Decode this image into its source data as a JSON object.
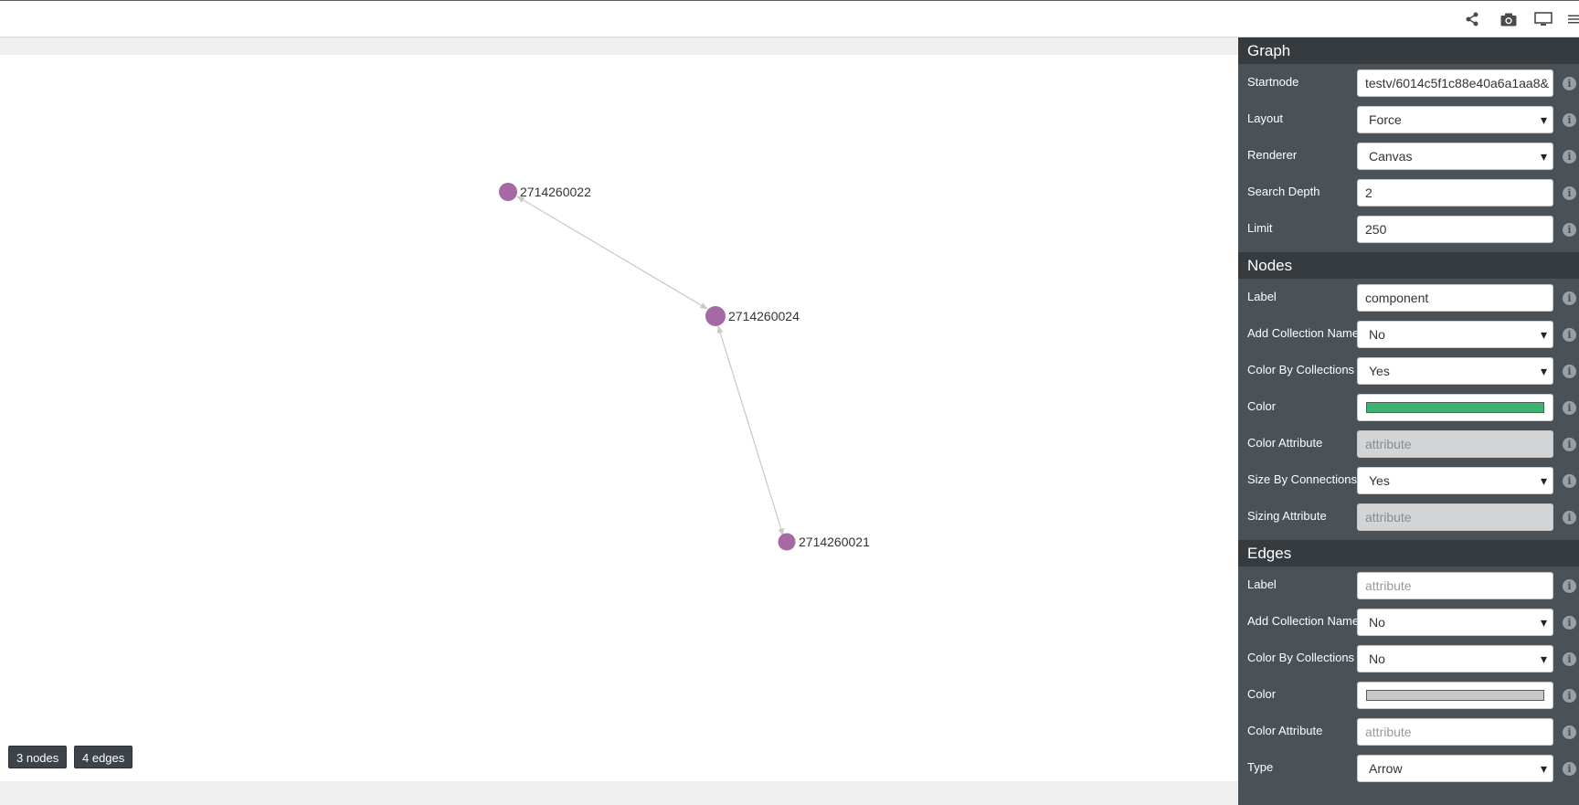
{
  "toolbar": {
    "icons": [
      "share-icon",
      "camera-icon",
      "monitor-icon",
      "menu-icon"
    ]
  },
  "graph": {
    "nodes": [
      {
        "id": "2714260022"
      },
      {
        "id": "2714260024"
      },
      {
        "id": "2714260021"
      }
    ],
    "node_color": "#a569a3",
    "edge_color": "#c8c8c8"
  },
  "badges": {
    "nodes": "3 nodes",
    "edges": "4 edges"
  },
  "panel": {
    "graph_section": {
      "title": "Graph",
      "startnode_label": "Startnode",
      "startnode_value": "testv/6014c5f1c88e40a6a1aa8&",
      "layout_label": "Layout",
      "layout_value": "Force",
      "renderer_label": "Renderer",
      "renderer_value": "Canvas",
      "depth_label": "Search Depth",
      "depth_value": "2",
      "limit_label": "Limit",
      "limit_value": "250"
    },
    "nodes_section": {
      "title": "Nodes",
      "label_label": "Label",
      "label_value": "component",
      "add_collection_label": "Add Collection Name",
      "add_collection_value": "No",
      "color_by_collections_label": "Color By Collections",
      "color_by_collections_value": "Yes",
      "color_label": "Color",
      "color_value": "#3cb371",
      "color_attribute_label": "Color Attribute",
      "color_attribute_placeholder": "attribute",
      "size_by_connections_label": "Size By Connections",
      "size_by_connections_value": "Yes",
      "sizing_attribute_label": "Sizing Attribute",
      "sizing_attribute_placeholder": "attribute"
    },
    "edges_section": {
      "title": "Edges",
      "label_label": "Label",
      "label_placeholder": "attribute",
      "add_collection_label": "Add Collection Name",
      "add_collection_value": "No",
      "color_by_collections_label": "Color By Collections",
      "color_by_collections_value": "No",
      "color_label": "Color",
      "color_value": "#c8c8c8",
      "color_attribute_label": "Color Attribute",
      "color_attribute_placeholder": "attribute",
      "type_label": "Type",
      "type_value": "Arrow"
    },
    "info_glyph": "i"
  }
}
